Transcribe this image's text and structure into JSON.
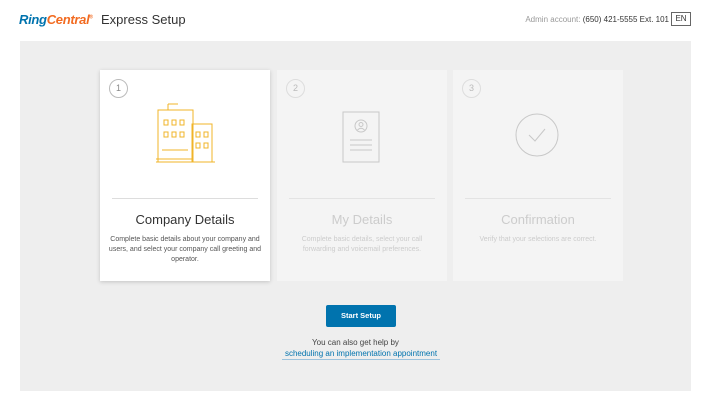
{
  "header": {
    "logo_ring": "Ring",
    "logo_central": "Central",
    "logo_tm": "®",
    "app_title": "Express Setup",
    "admin_label": "Admin account:",
    "admin_phone": "(650) 421-5555 Ext. 101",
    "language": "EN"
  },
  "steps": [
    {
      "number": "1",
      "title": "Company Details",
      "description": "Complete basic details about your company and users, and select your company call greeting and operator.",
      "icon": "building-icon",
      "active": true
    },
    {
      "number": "2",
      "title": "My Details",
      "description": "Complete basic details, select your call forwarding and voicemail preferences.",
      "icon": "id-card-icon",
      "active": false
    },
    {
      "number": "3",
      "title": "Confirmation",
      "description": "Verify that your selections are correct.",
      "icon": "check-circle-icon",
      "active": false
    }
  ],
  "actions": {
    "start_label": "Start Setup",
    "help_text": "You can also get help by",
    "help_link": "scheduling an implementation appointment"
  },
  "colors": {
    "brand_blue": "#0073ae",
    "brand_orange": "#f26b21",
    "building_yellow": "#f0b429",
    "panel_bg": "#eeeeee"
  }
}
